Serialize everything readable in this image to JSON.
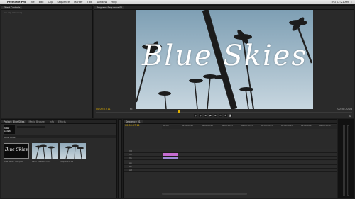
{
  "menu": {
    "apple": "",
    "app": "Premiere Pro",
    "items": [
      "File",
      "Edit",
      "Clip",
      "Sequence",
      "Marker",
      "Title",
      "Window",
      "Help"
    ],
    "clock": "Thu 12:21 AM"
  },
  "source_panel": {
    "tab": "Effect Controls",
    "empty_text": "(no clip selected)"
  },
  "program": {
    "tab": "Program: Sequence 01",
    "title_overlay": "Blue Skies",
    "timecode_left": "00:00:07:11",
    "timecode_right": "00:00:20:03",
    "fit": "Fit"
  },
  "project": {
    "tabs": [
      "Project: Blue Skies",
      "Media Browser",
      "Info",
      "Effects"
    ],
    "poster_title": "Blue Skies",
    "item_count": "3 Items",
    "bin_name": "Blue Skies",
    "thumbs": [
      {
        "caption": "Blue Skies Title.psd"
      },
      {
        "caption": "Palm Trees 01.mov"
      },
      {
        "caption": "Sequence 01"
      }
    ]
  },
  "timeline": {
    "tab": "Sequence 01",
    "timecode": "00:00:07:11",
    "ruler": [
      "00:00",
      "00:00:04:23",
      "00:00:09:23",
      "00:00:14:23",
      "00:00:19:23",
      "00:00:24:23",
      "00:00:29:23",
      "00:00:34:23",
      "00:00:39:22"
    ],
    "tracks": [
      "V3",
      "V2",
      "V1",
      "A1",
      "A2",
      "A3"
    ]
  },
  "colors": {
    "clip_pink": "#c56bd0",
    "timecode": "#e0b000",
    "playhead": "#d23a3a"
  }
}
